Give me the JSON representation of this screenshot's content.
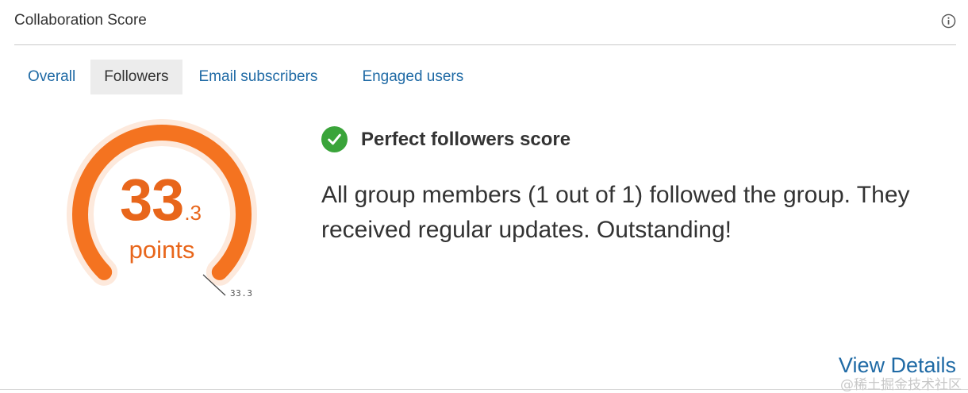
{
  "header": {
    "title": "Collaboration Score",
    "info_icon": "info-icon"
  },
  "tabs": [
    {
      "label": "Overall",
      "active": false
    },
    {
      "label": "Followers",
      "active": true
    },
    {
      "label": "Email subscribers",
      "active": false
    },
    {
      "label": "Engaged users",
      "active": false
    }
  ],
  "gauge": {
    "integer": "33",
    "decimal": ".3",
    "unit": "points",
    "tick_label": "33.3",
    "value": 33.3,
    "max": 33.3,
    "fill_fraction": 1.0,
    "color": "#f47320"
  },
  "status": {
    "icon": "check-circle-icon",
    "title": "Perfect followers score",
    "color": "#3aa43a"
  },
  "message": "All group members (1 out of 1) followed the group. They received regular updates. Outstanding!",
  "view_details_label": "View Details",
  "watermark": "@稀土掘金技术社区"
}
